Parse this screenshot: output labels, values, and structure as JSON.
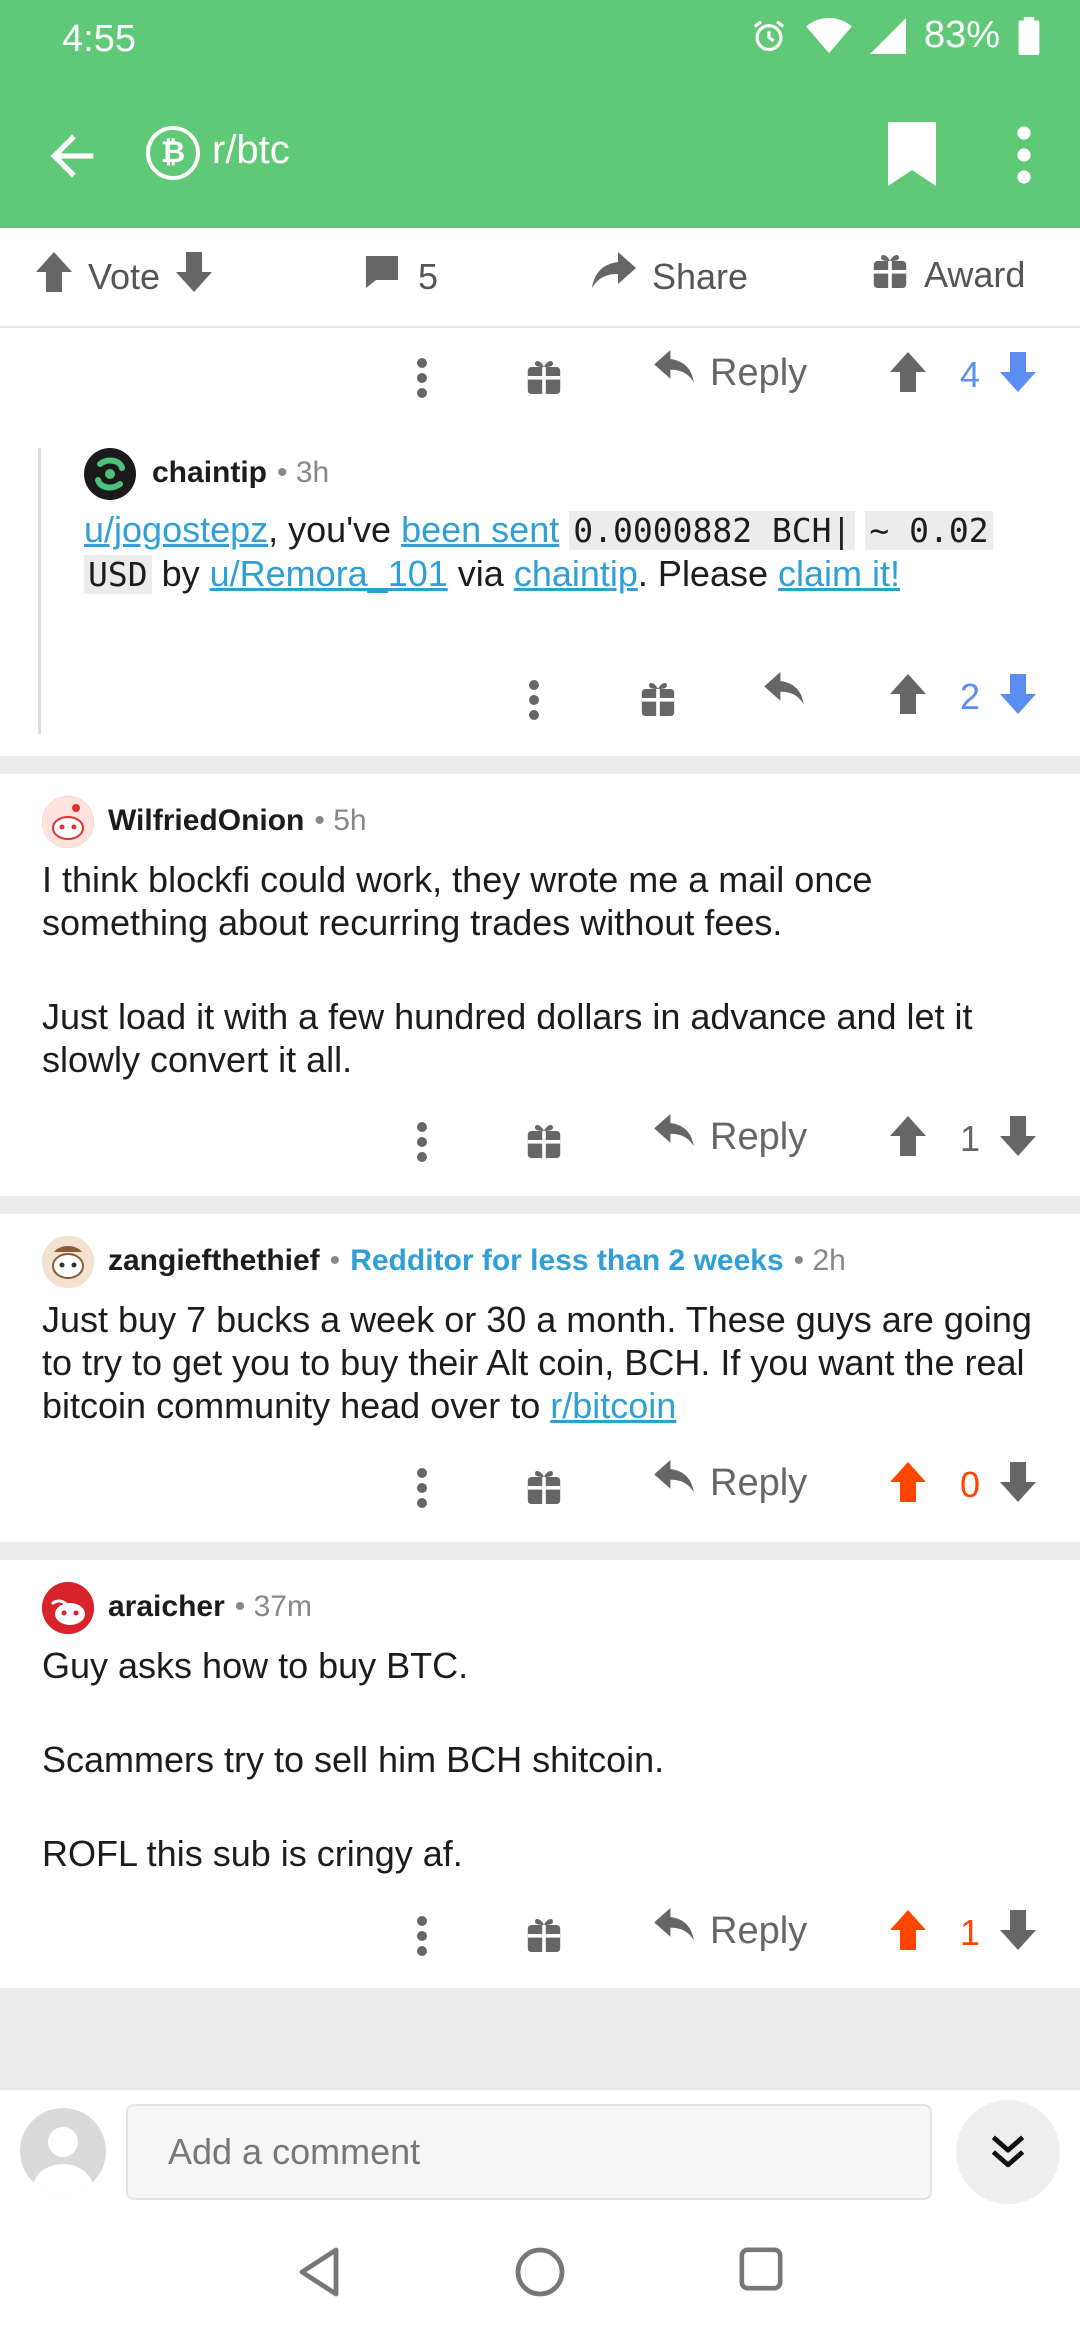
{
  "status": {
    "time": "4:55",
    "battery": "83%"
  },
  "toolbar": {
    "subreddit": "r/btc",
    "sub_logo": "₿"
  },
  "post_actions": {
    "vote": "Vote",
    "comments": "5",
    "share": "Share",
    "award": "Award"
  },
  "comments": [
    {
      "actions": {
        "reply": "Reply",
        "score": "4",
        "vote_state": "downvoted"
      }
    },
    {
      "author": "chaintip",
      "time": "3h",
      "body": {
        "user_link": "u/jogostepz",
        "t1": ", you've ",
        "sent_link": "been sent",
        "t2": " ",
        "amount_code": "0.0000882 BCH|",
        "t3": " ",
        "usd_code_a": "~ 0.02",
        "usd_code_b": "USD",
        "t4": " by ",
        "from_link": "u/Remora_101",
        "t5": " via ",
        "chaintip_link": "chaintip",
        "t6": ". Please ",
        "claim_link": "claim it!"
      },
      "actions": {
        "score": "2",
        "vote_state": "downvoted"
      }
    },
    {
      "author": "WilfriedOnion",
      "time": "5h",
      "body_p1": "I think blockfi could work, they wrote me a mail once something about recurring trades without fees.",
      "body_p2": "Just load it with a few hundred dollars in advance and let it slowly convert it all.",
      "actions": {
        "reply": "Reply",
        "score": "1",
        "vote_state": "none"
      }
    },
    {
      "author": "zangiefthethief",
      "flair": "Redditor for less than 2 weeks",
      "time": "2h",
      "body_text": "Just buy 7 bucks a week or 30 a month. These guys are going to try to get you to buy their Alt coin, BCH. If you want the real bitcoin community head over to ",
      "body_link": "r/bitcoin",
      "actions": {
        "reply": "Reply",
        "score": "0",
        "vote_state": "upvoted"
      }
    },
    {
      "author": "araicher",
      "time": "37m",
      "body_p1": "Guy asks how to buy BTC.",
      "body_p2": "Scammers try to sell him BCH shitcoin.",
      "body_p3": "ROFL this sub is cringy af.",
      "actions": {
        "reply": "Reply",
        "score": "1",
        "vote_state": "upvoted"
      }
    }
  ],
  "comment_bar": {
    "placeholder": "Add a comment"
  },
  "colors": {
    "header": "#5fc977",
    "upvote": "#ff4500",
    "downvote": "#5b8ef0",
    "link": "#2f9fd6",
    "icon_gray": "#666666"
  },
  "icons": [
    "back-arrow-icon",
    "bitcoin-icon",
    "bookmark-icon",
    "overflow-menu-icon",
    "comment-bubble-icon",
    "share-icon",
    "gift-icon",
    "reply-icon",
    "upvote-icon",
    "downvote-icon",
    "collapse-icon"
  ]
}
